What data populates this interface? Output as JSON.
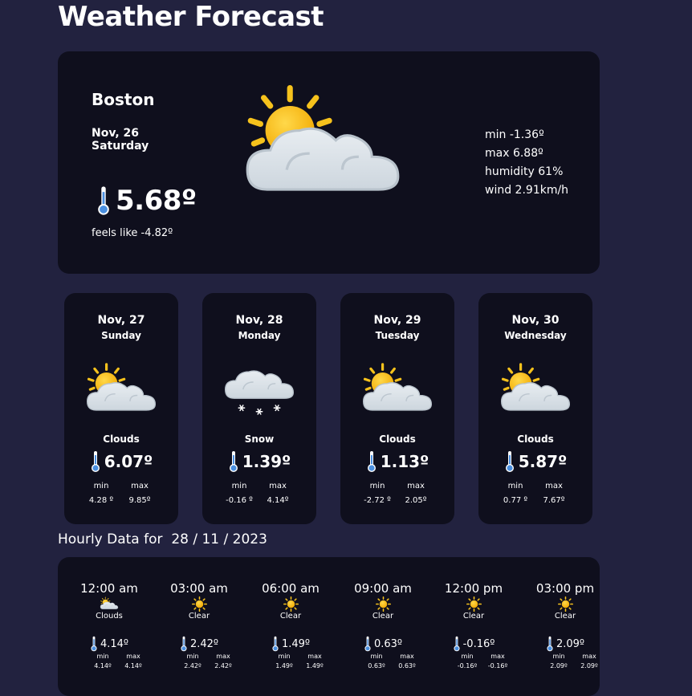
{
  "page": {
    "title": "Weather Forecast"
  },
  "current": {
    "city": "Boston",
    "date": "Nov, 26",
    "day": "Saturday",
    "temp": "5.68º",
    "feels_like": "feels like -4.82º",
    "icon": "partly-cloudy-icon",
    "min": "min -1.36º",
    "max": "max 6.88º",
    "humidity": "humidity 61%",
    "wind": "wind 2.91km/h"
  },
  "daily": [
    {
      "date": "Nov, 27",
      "day": "Sunday",
      "icon": "partly-cloudy-icon",
      "desc": "Clouds",
      "temp": "6.07º",
      "min_label": "min",
      "max_label": "max",
      "min": "4.28 º",
      "max": "9.85º"
    },
    {
      "date": "Nov, 28",
      "day": "Monday",
      "icon": "snow-icon",
      "desc": "Snow",
      "temp": "1.39º",
      "min_label": "min",
      "max_label": "max",
      "min": "-0.16 º",
      "max": "4.14º"
    },
    {
      "date": "Nov, 29",
      "day": "Tuesday",
      "icon": "partly-cloudy-icon",
      "desc": "Clouds",
      "temp": "1.13º",
      "min_label": "min",
      "max_label": "max",
      "min": "-2.72 º",
      "max": "2.05º"
    },
    {
      "date": "Nov, 30",
      "day": "Wednesday",
      "icon": "partly-cloudy-icon",
      "desc": "Clouds",
      "temp": "5.87º",
      "min_label": "min",
      "max_label": "max",
      "min": "0.77 º",
      "max": "7.67º"
    }
  ],
  "hourly": {
    "label": "Hourly Data for",
    "date": "28 / 11 / 2023",
    "items": [
      {
        "time": "12:00 am",
        "icon": "partly-cloudy-icon",
        "desc": "Clouds",
        "temp": "4.14º",
        "min_label": "min",
        "max_label": "max",
        "min": "4.14º",
        "max": "4.14º"
      },
      {
        "time": "03:00 am",
        "icon": "sun-icon",
        "desc": "Clear",
        "temp": "2.42º",
        "min_label": "min",
        "max_label": "max",
        "min": "2.42º",
        "max": "2.42º"
      },
      {
        "time": "06:00 am",
        "icon": "sun-icon",
        "desc": "Clear",
        "temp": "1.49º",
        "min_label": "min",
        "max_label": "max",
        "min": "1.49º",
        "max": "1.49º"
      },
      {
        "time": "09:00 am",
        "icon": "sun-icon",
        "desc": "Clear",
        "temp": "0.63º",
        "min_label": "min",
        "max_label": "max",
        "min": "0.63º",
        "max": "0.63º"
      },
      {
        "time": "12:00 pm",
        "icon": "sun-icon",
        "desc": "Clear",
        "temp": "-0.16º",
        "min_label": "min",
        "max_label": "max",
        "min": "-0.16º",
        "max": "-0.16º"
      },
      {
        "time": "03:00 pm",
        "icon": "sun-icon",
        "desc": "Clear",
        "temp": "2.09º",
        "min_label": "min",
        "max_label": "max",
        "min": "2.09º",
        "max": "2.09º"
      }
    ]
  },
  "colors": {
    "background": "#22223f",
    "card": "#0f0f1d",
    "sun": "#f6c21c",
    "cloud": "#d8dfe6",
    "thermometer": "#4a8fe0"
  }
}
